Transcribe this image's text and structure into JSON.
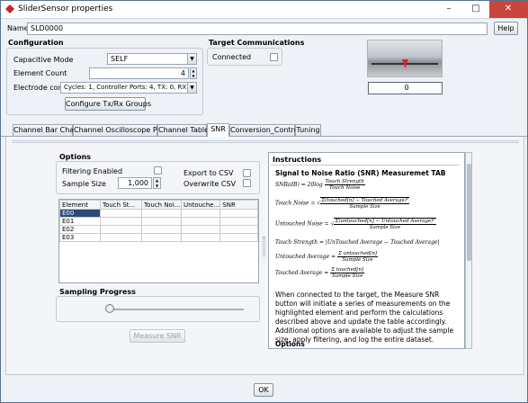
{
  "window": {
    "title": "SliderSensor properties",
    "close_glyph": "✕",
    "minimize_glyph": "–",
    "maximize_glyph": "□"
  },
  "name_row": {
    "label": "Name:",
    "value": "SLD0000",
    "help_label": "Help"
  },
  "configuration": {
    "title": "Configuration",
    "capacitive_mode_label": "Capacitive Mode",
    "capacitive_mode_value": "SELF",
    "element_count_label": "Element Count",
    "element_count_value": "4",
    "electrode_config_label": "Electrode config",
    "electrode_config_value": "Cycles: 1, Controller Ports: 4, TX: 0, RX: 4",
    "configure_button": "Configure Tx/Rx Groups"
  },
  "target": {
    "title": "Target Communications",
    "connected_label": "Connected"
  },
  "slider_preview": {
    "value": "0"
  },
  "tabs": [
    "Channel Bar Chart",
    "Channel Oscilloscope Plot",
    "Channel Table",
    "SNR",
    "Conversion_Control",
    "Tuning"
  ],
  "options": {
    "title": "Options",
    "filtering_label": "Filtering Enabled",
    "export_label": "Export to CSV",
    "sample_size_label": "Sample Size",
    "sample_size_value": "1,000",
    "overwrite_label": "Overwrite CSV"
  },
  "table": {
    "headers": [
      "Element",
      "Touch St...",
      "Touch Noi...",
      "Untouche...",
      "SNR"
    ],
    "rows": [
      "E00",
      "E01",
      "E02",
      "E03"
    ]
  },
  "sampling": {
    "title": "Sampling Progress",
    "progress": 0.0,
    "measure_button": "Measure SNR"
  },
  "instructions": {
    "title": "Instructions",
    "heading": "Signal to Noise Ratio (SNR) Measuremet TAB",
    "eq_snr": "SNR(dB) = 20log",
    "eq_snr_num": "Touch Strength",
    "eq_snr_den": "Touch Noise",
    "eq_tn": "Touch Noise =",
    "eq_tn_num": "Σ(touched[n] − Touched Average)²",
    "eq_tn_den": "Sample Size",
    "eq_un": "Untouched Noise =",
    "eq_un_num": "Σ(untouched[n] − Untouched Average)²",
    "eq_un_den": "Sample Size",
    "eq_ts": "Touch Strength = |UnTouched Average − Touched Average|",
    "eq_ua": "Untouched Average =",
    "eq_ua_num": "Σ untouched[n]",
    "eq_ua_den": "Sample Size",
    "eq_ta": "Touched Average =",
    "eq_ta_num": "Σ touched[n]",
    "eq_ta_den": "Sample Size",
    "body": "When connected to the target, the Measure SNR button will initiate a series of measurements on the highlighted element and perform the calculations described above and update the table accordingly. Additional options are available to adjust the sample size, apply filtering, and log the entire dataset.",
    "sub_heading": "Options"
  },
  "ok_button": "OK"
}
